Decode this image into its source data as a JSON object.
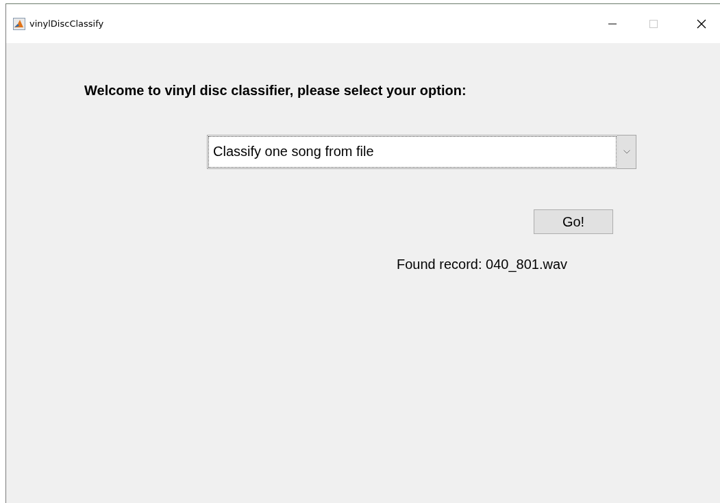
{
  "window": {
    "title": "vinylDiscClassify"
  },
  "heading": "Welcome to vinyl disc classifier, please select your option:",
  "dropdown": {
    "value": "Classify one song from file"
  },
  "go_button": "Go!",
  "status": "Found record: 040_801.wav"
}
